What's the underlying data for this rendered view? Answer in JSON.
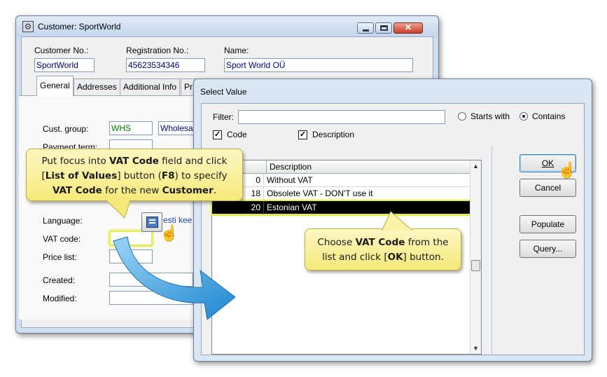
{
  "customer_window": {
    "title": "Customer: SportWorld",
    "customer_no_label": "Customer No.:",
    "customer_no": "SportWorld",
    "registration_no_label": "Registration No.:",
    "registration_no": "45623534346",
    "name_label": "Name:",
    "name": "Sport World OÜ",
    "tabs": [
      {
        "label": "General"
      },
      {
        "label": "Addresses"
      },
      {
        "label": "Additional Info"
      },
      {
        "label": "Pr"
      }
    ],
    "cust_group_label": "Cust. group:",
    "cust_group_code": "WHS",
    "cust_group_desc": "Wholesa",
    "payment_term_label": "Payment term:",
    "language_label": "Language:",
    "language_value": "esti kee",
    "vat_code_label": "VAT code:",
    "vat_code_value": "",
    "price_list_label": "Price list:",
    "created_label": "Created:",
    "modified_label": "Modified:"
  },
  "select_dialog": {
    "title": "Select Value",
    "filter_label": "Filter:",
    "filter_value": "",
    "starts_with_label": "Starts with",
    "contains_label": "Contains",
    "code_check_label": "Code",
    "description_check_label": "Description",
    "column_header_code": "",
    "column_header_description": "Description",
    "rows": [
      {
        "code": "0",
        "description": "Without VAT"
      },
      {
        "code": "18",
        "description": "Obsolete VAT - DON'T use it"
      },
      {
        "code": "20",
        "description": "Estonian VAT"
      }
    ],
    "ok_label": "OK",
    "cancel_label": "Cancel",
    "populate_label": "Populate",
    "query_label": "Query..."
  },
  "callouts": {
    "callout1_a": "Put focus into ",
    "callout1_b": "VAT Code",
    "callout1_c": " field and click",
    "callout1_d": "[",
    "callout1_e": "List of Values",
    "callout1_f": "] button (",
    "callout1_g": "F8",
    "callout1_h": ") to specify",
    "callout1_i": "VAT Code",
    "callout1_j": " for the new ",
    "callout1_k": "Customer",
    "callout1_l": ".",
    "callout2_a": "Choose ",
    "callout2_b": "VAT Code",
    "callout2_c": " from the",
    "callout2_d": "list and click [",
    "callout2_e": "OK",
    "callout2_f": "] button."
  },
  "colors": {
    "callout_fill": "#f5e97a",
    "highlight": "#e5ec3a",
    "arrow": "#2a94d8",
    "selected_row": "#000000"
  }
}
